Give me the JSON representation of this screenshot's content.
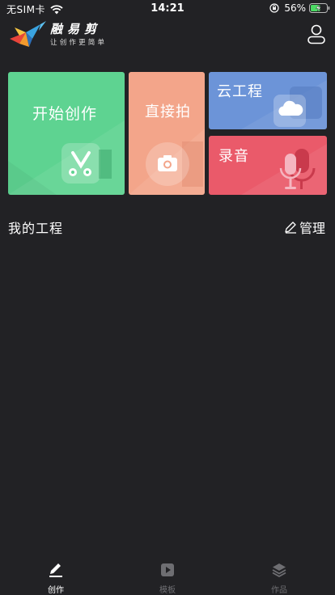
{
  "status_bar": {
    "carrier": "无SIM卡",
    "time": "14:21",
    "battery": "56%"
  },
  "header": {
    "app_name": "融易剪",
    "slogan": "让创作更简单"
  },
  "tiles": {
    "create": "开始创作",
    "shoot": "直接拍",
    "cloud": "云工程",
    "record": "录音"
  },
  "projects": {
    "title": "我的工程",
    "manage": "管理"
  },
  "tabs": [
    {
      "label": "创作",
      "icon": "pencil-icon",
      "active": true
    },
    {
      "label": "模板",
      "icon": "play-square-icon",
      "active": false
    },
    {
      "label": "作品",
      "icon": "layers-icon",
      "active": false
    }
  ],
  "colors": {
    "background": "#222225",
    "create_tile": "#5ed391",
    "shoot_tile": "#f3a58a",
    "cloud_tile": "#6c94d8",
    "record_tile": "#ea5a6a"
  }
}
